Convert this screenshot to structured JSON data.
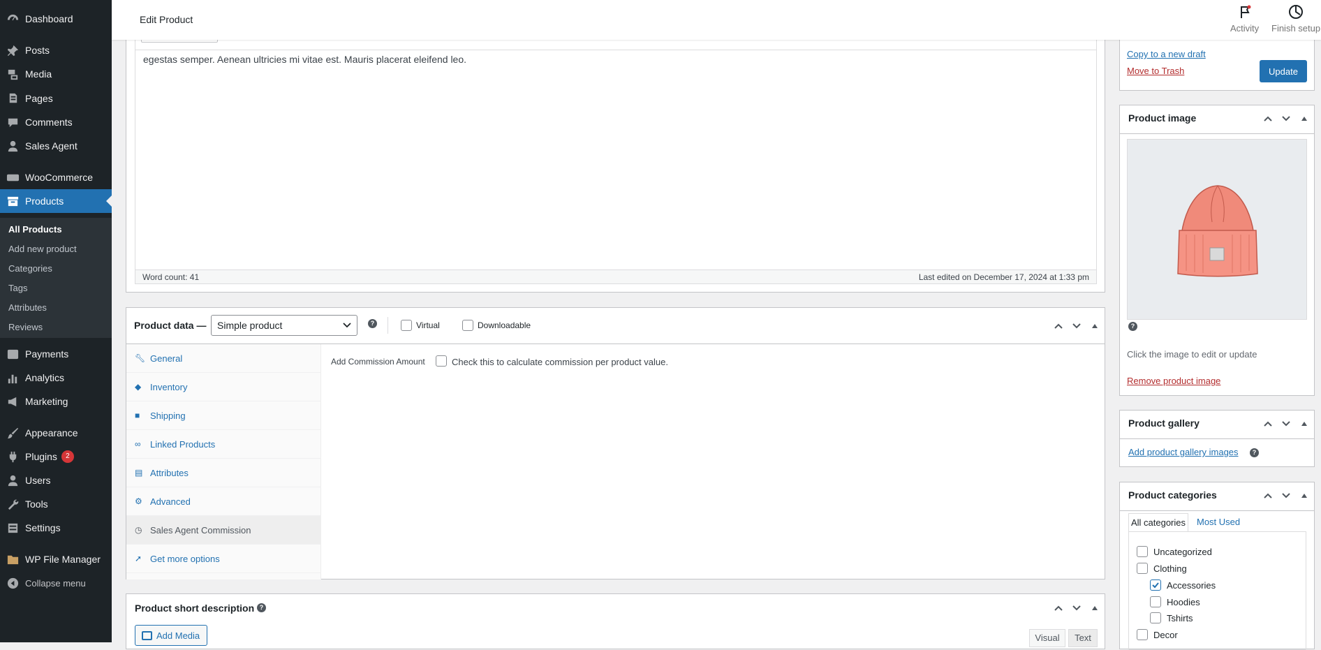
{
  "sidebar": {
    "items": [
      {
        "label": "Dashboard",
        "icon": "dashboard-icon"
      },
      {
        "label": "Posts",
        "icon": "pin-icon"
      },
      {
        "label": "Media",
        "icon": "media-icon"
      },
      {
        "label": "Pages",
        "icon": "pages-icon"
      },
      {
        "label": "Comments",
        "icon": "comments-icon"
      },
      {
        "label": "Sales Agent",
        "icon": "user-icon"
      },
      {
        "label": "WooCommerce",
        "icon": "woo-icon"
      },
      {
        "label": "Products",
        "icon": "archive-icon"
      },
      {
        "label": "Payments",
        "icon": "dollar-icon"
      },
      {
        "label": "Analytics",
        "icon": "bar-chart-icon"
      },
      {
        "label": "Marketing",
        "icon": "megaphone-icon"
      },
      {
        "label": "Appearance",
        "icon": "paintbrush-icon"
      },
      {
        "label": "Plugins",
        "icon": "plug-icon",
        "badge": "2"
      },
      {
        "label": "Users",
        "icon": "users-icon"
      },
      {
        "label": "Tools",
        "icon": "wrench-icon"
      },
      {
        "label": "Settings",
        "icon": "settings-icon"
      },
      {
        "label": "WP File Manager",
        "icon": "folder-icon"
      },
      {
        "label": "Collapse menu",
        "icon": "collapse-icon"
      }
    ],
    "submenu": [
      "All Products",
      "Add new product",
      "Categories",
      "Tags",
      "Attributes",
      "Reviews"
    ]
  },
  "topbar": {
    "title": "Edit Product",
    "activity": "Activity",
    "finish_setup": "Finish setup"
  },
  "editor": {
    "text": "egestas semper. Aenean ultricies mi vitae est. Mauris placerat eleifend leo.",
    "word_count": "Word count: 41",
    "last_edited": "Last edited on December 17, 2024 at 1:33 pm"
  },
  "product_data": {
    "title": "Product data —",
    "type_value": "Simple product",
    "virtual": "Virtual",
    "downloadable": "Downloadable",
    "tabs": [
      "General",
      "Inventory",
      "Shipping",
      "Linked Products",
      "Attributes",
      "Advanced",
      "Sales Agent Commission",
      "Get more options"
    ],
    "commission_label": "Add Commission Amount",
    "commission_check": "Check this to calculate commission per product value."
  },
  "short_description": {
    "title": "Product short description",
    "add_media": "Add Media",
    "visual": "Visual",
    "text": "Text"
  },
  "publish": {
    "copy_draft": "Copy to a new draft",
    "trash": "Move to Trash",
    "update": "Update"
  },
  "product_image": {
    "title": "Product image",
    "hint": "Click the image to edit or update",
    "remove": "Remove product image"
  },
  "gallery": {
    "title": "Product gallery",
    "add": "Add product gallery images"
  },
  "categories": {
    "title": "Product categories",
    "tab_all": "All categories",
    "tab_used": "Most Used",
    "items": [
      {
        "label": "Uncategorized",
        "checked": false
      },
      {
        "label": "Clothing",
        "checked": false
      },
      {
        "label": "Accessories",
        "checked": true
      },
      {
        "label": "Hoodies",
        "checked": false
      },
      {
        "label": "Tshirts",
        "checked": false
      },
      {
        "label": "Decor",
        "checked": false
      }
    ]
  },
  "colors": {
    "sidebar": "#1d2327",
    "accent": "#2271b1",
    "badge": "#d63638",
    "beanie": "#f08a7a"
  }
}
